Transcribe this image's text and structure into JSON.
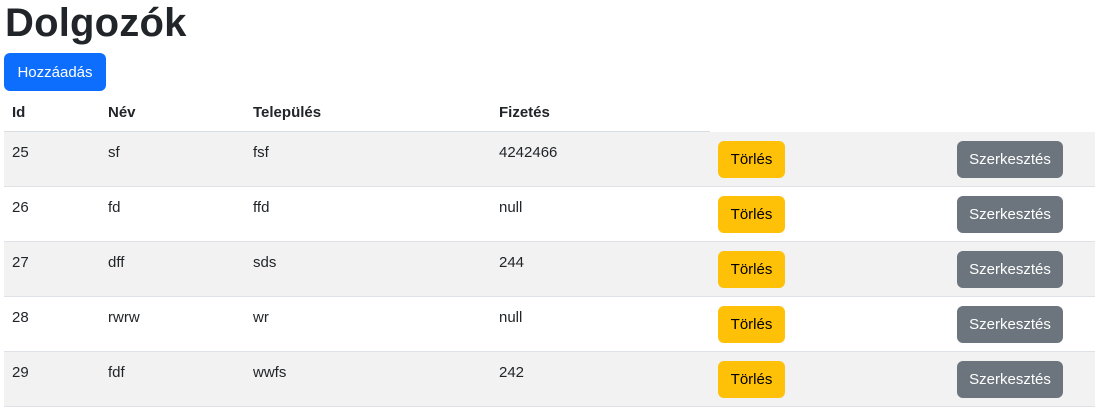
{
  "page": {
    "title": "Dolgozók",
    "add_button_label": "Hozzáadás"
  },
  "table": {
    "columns": [
      "Id",
      "Név",
      "Település",
      "Fizetés"
    ],
    "rows": [
      {
        "id": "25",
        "nev": "sf",
        "telepules": "fsf",
        "fizetes": "4242466"
      },
      {
        "id": "26",
        "nev": "fd",
        "telepules": "ffd",
        "fizetes": "null"
      },
      {
        "id": "27",
        "nev": "dff",
        "telepules": "sds",
        "fizetes": "244"
      },
      {
        "id": "28",
        "nev": "rwrw",
        "telepules": "wr",
        "fizetes": "null"
      },
      {
        "id": "29",
        "nev": "fdf",
        "telepules": "wwfs",
        "fizetes": "242"
      }
    ],
    "delete_label": "Törlés",
    "edit_label": "Szerkesztés"
  },
  "colors": {
    "primary": "#0d6efd",
    "warning": "#ffc107",
    "secondary": "#6c757d",
    "stripe": "#f2f2f2"
  }
}
